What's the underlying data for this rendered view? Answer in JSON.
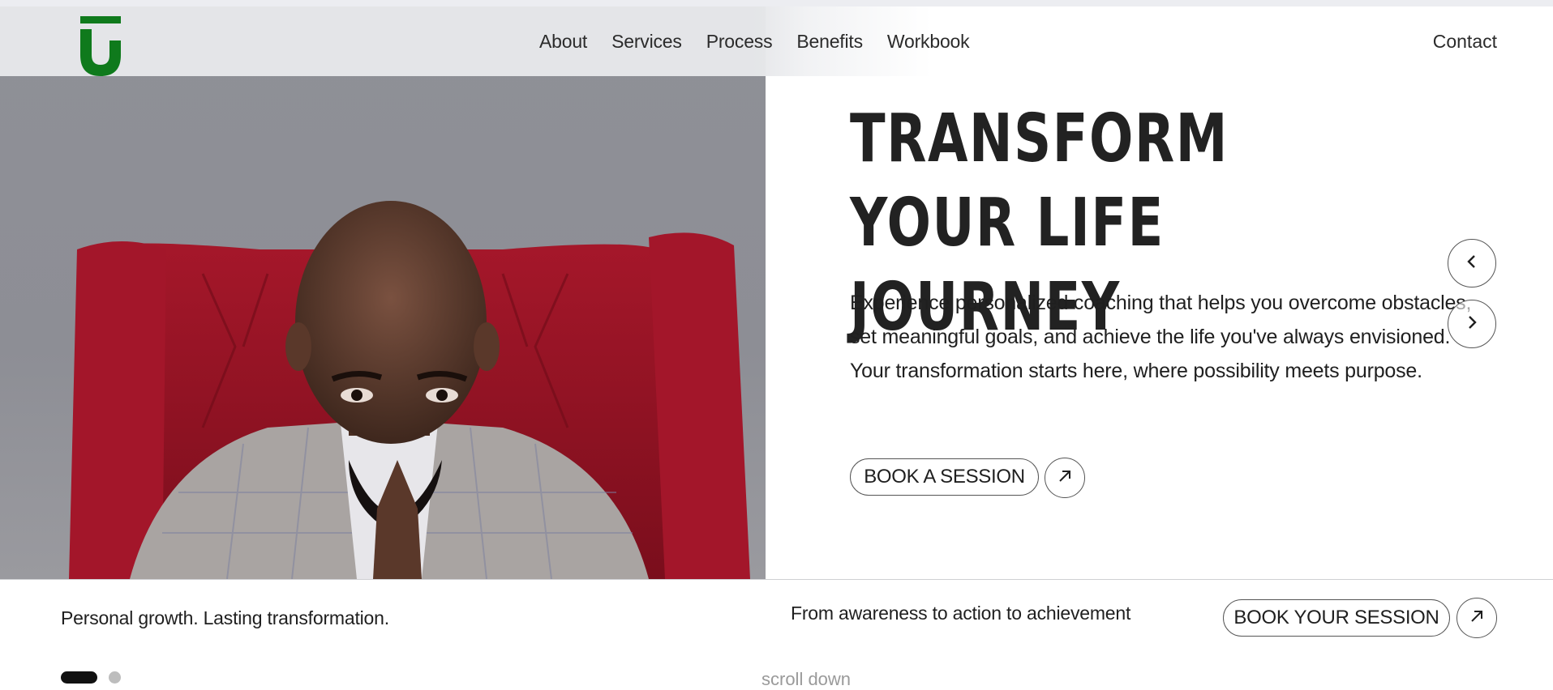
{
  "header": {
    "logo_name": "brand-logo",
    "nav": [
      "About",
      "Services",
      "Process",
      "Benefits",
      "Workbook"
    ],
    "contact": "Contact",
    "accent_color": "#0f7a1c"
  },
  "hero": {
    "title_line1": "TRANSFORM YOUR LIFE",
    "title_line2": "JOURNEY",
    "description": "Experience personalized coaching that helps you overcome obstacles, set meaningful goals, and achieve the life you've always envisioned. Your transformation starts here, where possibility meets purpose.",
    "cta": "BOOK A SESSION",
    "prev_icon": "chevron-left-icon",
    "next_icon": "chevron-right-icon",
    "cta_icon": "arrow-up-right-icon"
  },
  "footer_strip": {
    "tagline_left": "Personal growth. Lasting transformation.",
    "tagline_mid": "From awareness to action to achievement",
    "cta": "BOOK YOUR SESSION",
    "scroll": "scroll down",
    "slides_total": 2,
    "slide_active": 1
  }
}
